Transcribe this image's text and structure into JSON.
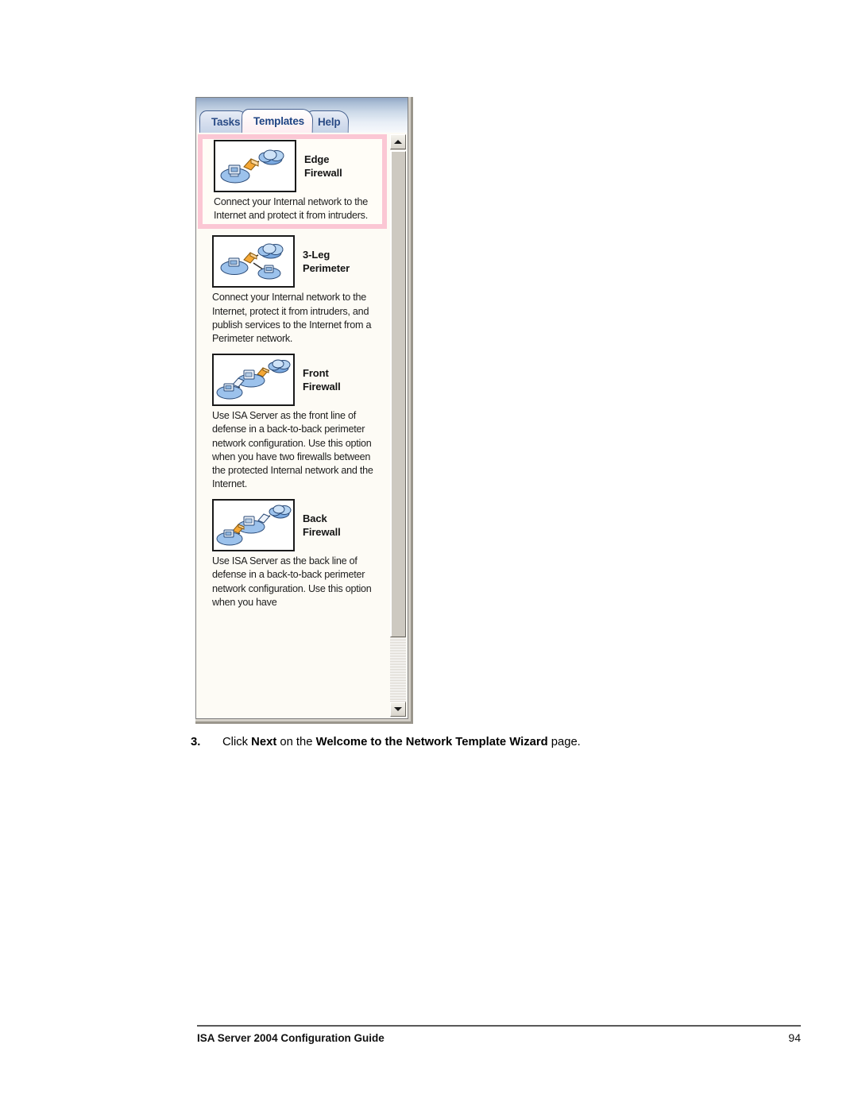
{
  "document": {
    "step": {
      "number": "3.",
      "prefix": "Click ",
      "bold1": "Next",
      "middle": " on the ",
      "bold2": "Welcome to the Network Template Wizard",
      "suffix": " page."
    },
    "footer": {
      "title": "ISA Server 2004 Configuration Guide",
      "page": "94"
    }
  },
  "screenshot": {
    "tabs": [
      {
        "label": "Tasks",
        "active": false
      },
      {
        "label": "Templates",
        "active": true
      },
      {
        "label": "Help",
        "active": false
      }
    ],
    "templates": [
      {
        "title_line1": "Edge",
        "title_line2": "Firewall",
        "icon": "network-firewall-internet-icon",
        "description": "Connect your Internal network to the Internet and protect it from intruders.",
        "selected": true
      },
      {
        "title_line1": "3-Leg",
        "title_line2": "Perimeter",
        "icon": "network-firewall-three-leg-icon",
        "description": "Connect your Internal network to the Internet, protect it from intruders, and publish services to the Internet from a Perimeter network.",
        "selected": false
      },
      {
        "title_line1": "Front",
        "title_line2": "Firewall",
        "icon": "network-front-firewall-icon",
        "description": "Use ISA Server as the front line of defense in a back-to-back perimeter network configuration. Use this option when you have two firewalls between the protected Internal network and the Internet.",
        "selected": false
      },
      {
        "title_line1": "Back",
        "title_line2": "Firewall",
        "icon": "network-back-firewall-icon",
        "description": "Use ISA Server as the back line of defense in a back-to-back perimeter network configuration. Use this option when you have",
        "selected": false
      }
    ],
    "scrollbar": {
      "up_icon": "scroll-up-arrow-icon",
      "down_icon": "scroll-down-arrow-icon"
    },
    "colors": {
      "selection_border": "#fbc7d4",
      "tab_text": "#2b4c86",
      "panel_background": "#fdfbf5"
    }
  }
}
